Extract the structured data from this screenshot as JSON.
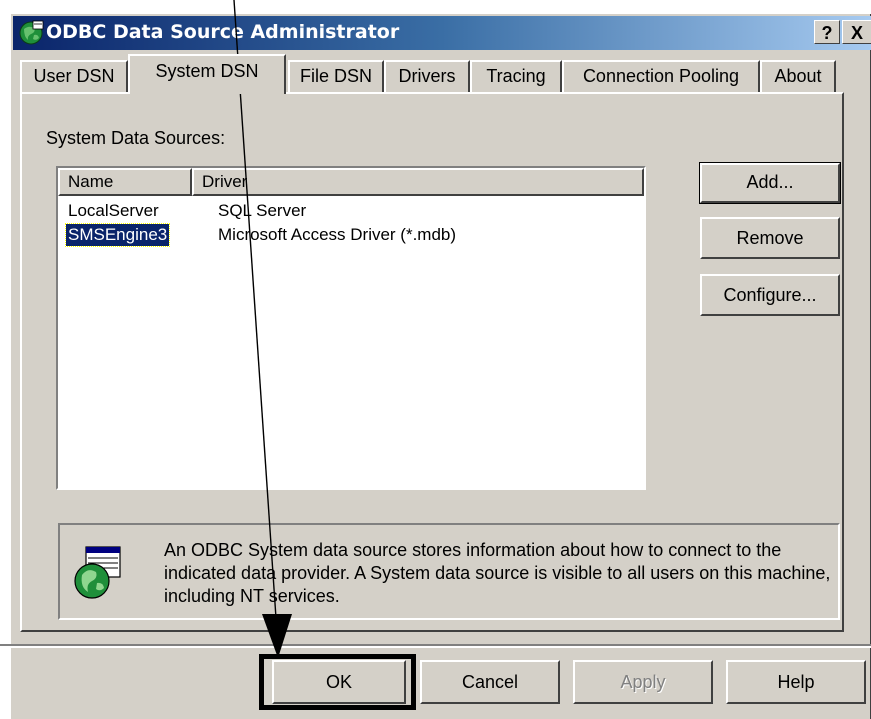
{
  "window": {
    "title": "ODBC Data Source Administrator",
    "help_button": "?",
    "close_button": "X"
  },
  "tabs": [
    {
      "label": "User DSN",
      "active": false
    },
    {
      "label": "System DSN",
      "active": true
    },
    {
      "label": "File DSN",
      "active": false
    },
    {
      "label": "Drivers",
      "active": false
    },
    {
      "label": "Tracing",
      "active": false
    },
    {
      "label": "Connection Pooling",
      "active": false
    },
    {
      "label": "About",
      "active": false
    }
  ],
  "panel": {
    "label": "System Data Sources:",
    "columns": [
      "Name",
      "Driver"
    ],
    "rows": [
      {
        "name": "LocalServer",
        "driver": "SQL Server",
        "selected": false
      },
      {
        "name": "SMSEngine3",
        "driver": "Microsoft Access Driver (*.mdb)",
        "selected": true
      }
    ],
    "side_buttons": {
      "add": "Add...",
      "remove": "Remove",
      "configure": "Configure..."
    },
    "info_text": "An ODBC System data source stores information about how to connect to the indicated data provider.  A System data source is visible to all users on this machine, including NT services.",
    "info_icon": "database-globe-icon"
  },
  "footer_buttons": {
    "ok": "OK",
    "cancel": "Cancel",
    "apply": "Apply",
    "help": "Help"
  },
  "annotation": {
    "type": "arrow-pointing-to-ok",
    "color": "#000000"
  },
  "colors": {
    "face": "#d4d0c8",
    "title_start": "#0a246a",
    "title_end": "#a6caf0",
    "selection": "#0a246a"
  }
}
